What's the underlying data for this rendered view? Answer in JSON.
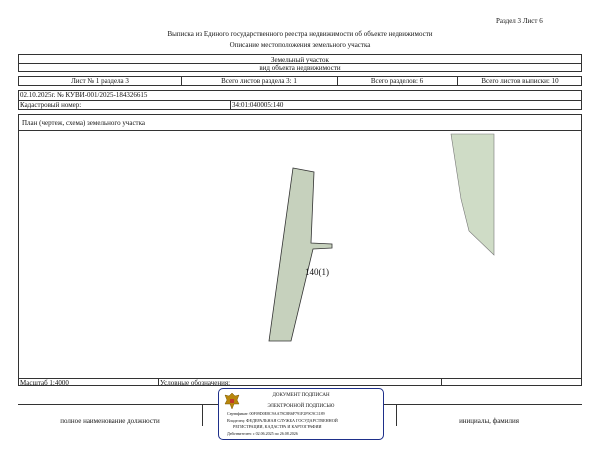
{
  "header": {
    "section_sheet": "Раздел 3   Лист 6",
    "title": "Выписка из Единого государственного реестра недвижимости об объекте недвижимости",
    "subtitle": "Описание местоположения земельного участка"
  },
  "object": {
    "type": "Земельный участок",
    "type_caption": "вид объекта недвижимости"
  },
  "sheet_info": {
    "sheet_of_section": "Лист № 1 раздела 3",
    "section_sheets_total": "Всего листов раздела 3: 1",
    "sections_total": "Всего разделов: 6",
    "extract_sheets_total": "Всего листов выписки: 10"
  },
  "record": {
    "date_number": "02.10.2025г. № КУВИ-001/2025-184326615",
    "cadastral_label": "Кадастровый номер:",
    "cadastral_value": "34:01:040005:140"
  },
  "plan": {
    "caption": "План (чертеж, схема) земельного участка",
    "parcel_label": "140(1)",
    "parcel_fill": "#c6d1bd",
    "neighbor_fill": "#cfdcc6"
  },
  "legend": {
    "scale": "Масштаб 1:4000",
    "symbols_label": "Условные обозначения:"
  },
  "signature": {
    "position_caption": "полное наименование должности",
    "name_caption": "инициалы, фамилия",
    "stamp": {
      "line1": "ДОКУМЕНТ ПОДПИСАН",
      "line2": "ЭЛЕКТРОННОЙ ПОДПИСЬЮ",
      "cert": "Сертификат: 00F09D0E8C9AA78C8B6F791F2F9C9C1189",
      "owner_1": "Владелец: ФЕДЕРАЛЬНАЯ СЛУЖБА ГОСУДАРСТВЕННОЙ",
      "owner_2": "РЕГИСТРАЦИИ, КАДАСТРА И КАРТОГРАФИИ",
      "valid": "Действителен: с 02.06.2025 по 26.08.2026",
      "border_color": "#1e2f8a"
    }
  }
}
